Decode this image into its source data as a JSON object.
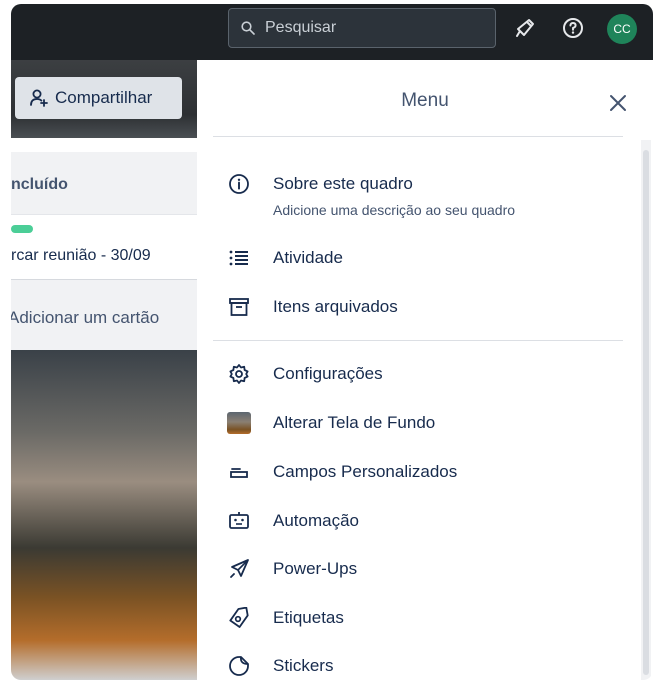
{
  "topbar": {
    "search_placeholder": "Pesquisar",
    "avatar_initials": "CC"
  },
  "board": {
    "share_label": "Compartilhar",
    "list_title": "ncluído",
    "card_title": "rcar reunião - 30/09",
    "add_card_label": "Adicionar um cartão"
  },
  "menu": {
    "title": "Menu",
    "items": [
      {
        "label": "Sobre este quadro",
        "sub": "Adicione uma descrição ao seu quadro",
        "icon": "info-icon"
      },
      {
        "label": "Atividade",
        "icon": "activity-list-icon"
      },
      {
        "label": "Itens arquivados",
        "icon": "archive-icon"
      },
      {
        "label": "Configurações",
        "icon": "gear-icon"
      },
      {
        "label": "Alterar Tela de Fundo",
        "icon": "background-thumbnail"
      },
      {
        "label": "Campos Personalizados",
        "icon": "custom-fields-icon"
      },
      {
        "label": "Automação",
        "icon": "robot-icon"
      },
      {
        "label": "Power-Ups",
        "icon": "rocket-icon"
      },
      {
        "label": "Etiquetas",
        "icon": "tag-icon"
      },
      {
        "label": "Stickers",
        "icon": "sticker-icon"
      }
    ]
  },
  "colors": {
    "topbar": "#1d2125",
    "avatar": "#1f845a",
    "label_green": "#4bce97",
    "text": "#172b4d"
  }
}
